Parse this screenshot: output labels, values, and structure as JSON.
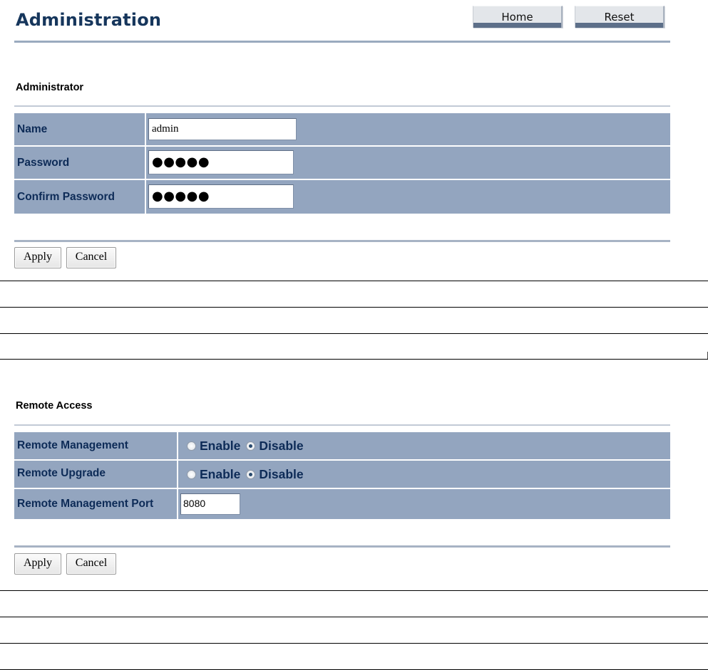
{
  "header": {
    "title": "Administration",
    "home_label": "Home",
    "reset_label": "Reset"
  },
  "administrator": {
    "section_title": "Administrator",
    "fields": {
      "name": {
        "label": "Name",
        "value": "admin"
      },
      "password": {
        "label": "Password",
        "value": "●●●●●"
      },
      "confirm_password": {
        "label": "Confirm Password",
        "value": "●●●●●"
      }
    },
    "apply_label": "Apply",
    "cancel_label": "Cancel"
  },
  "remote_access": {
    "section_title": "Remote Access",
    "remote_management": {
      "label": "Remote Management",
      "options": [
        "Enable",
        "Disable"
      ],
      "selected": "Disable"
    },
    "remote_upgrade": {
      "label": "Remote Upgrade",
      "options": [
        "Enable",
        "Disable"
      ],
      "selected": "Disable"
    },
    "remote_management_port": {
      "label": "Remote Management Port",
      "value": "8080"
    },
    "apply_label": "Apply",
    "cancel_label": "Cancel"
  },
  "colors": {
    "title": "#16365c",
    "row_background": "#93a5bf",
    "label_text": "#0d2b57"
  }
}
